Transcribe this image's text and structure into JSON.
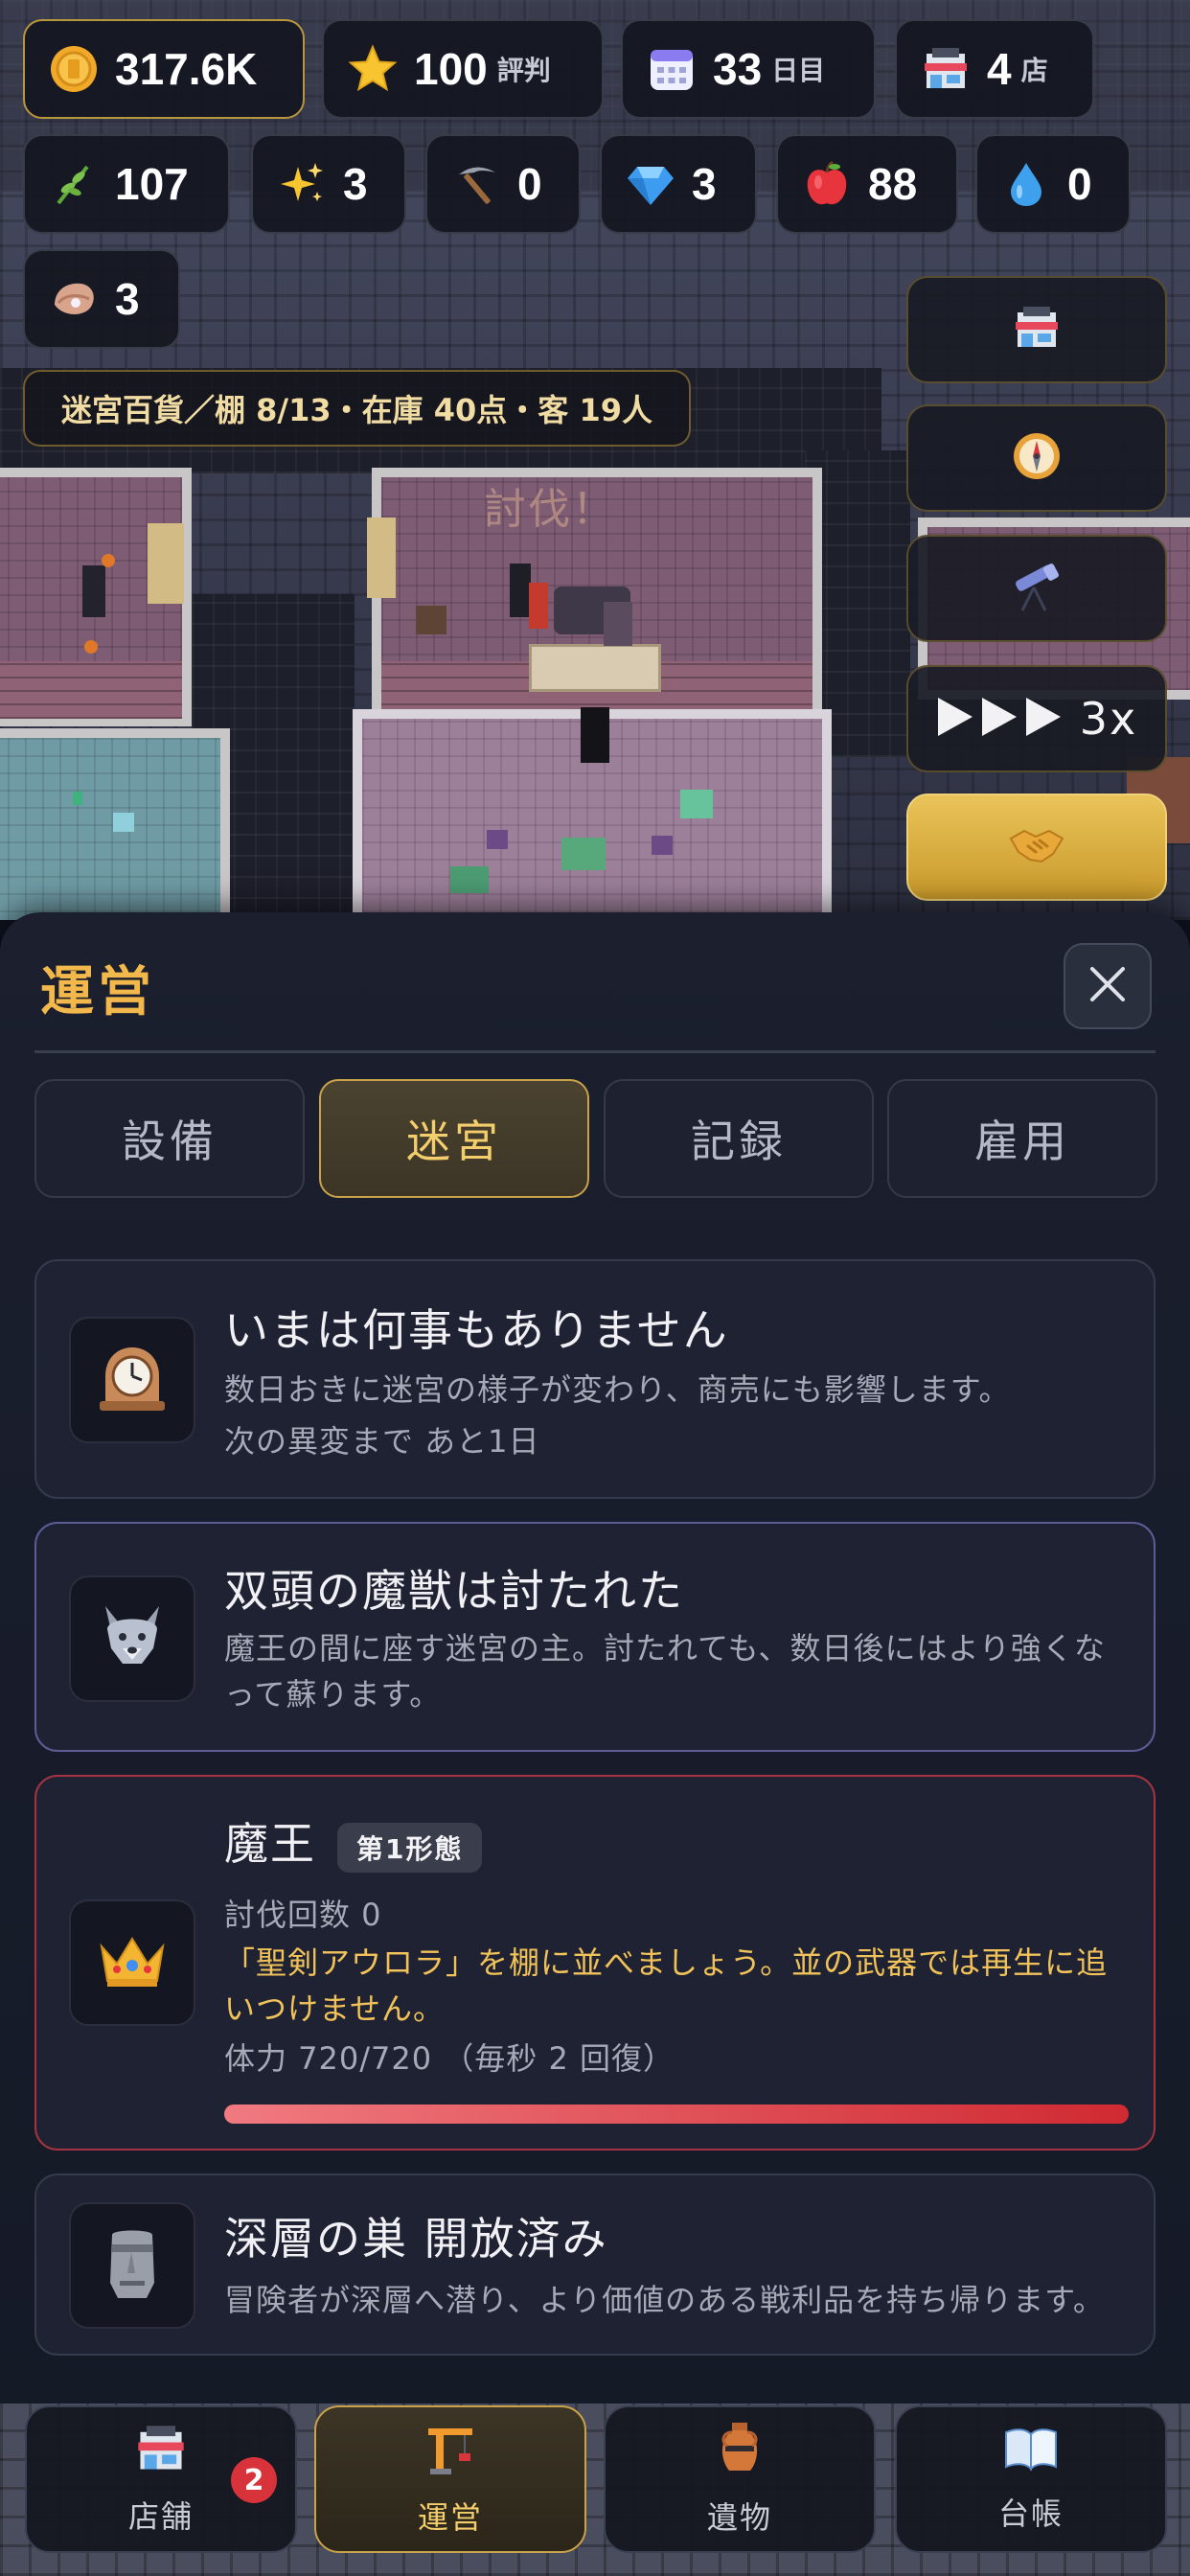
{
  "hud": {
    "row1": [
      {
        "icon": "coin-icon",
        "value": "317.6K",
        "unit": ""
      },
      {
        "icon": "star-icon",
        "value": "100",
        "unit": "評判"
      },
      {
        "icon": "calendar-icon",
        "value": "33",
        "unit": "日目"
      },
      {
        "icon": "store-icon",
        "value": "4",
        "unit": "店"
      }
    ],
    "row2": [
      {
        "icon": "herb-icon",
        "value": "107"
      },
      {
        "icon": "sparkle-icon",
        "value": "3"
      },
      {
        "icon": "pickaxe-icon",
        "value": "0"
      },
      {
        "icon": "gem-icon",
        "value": "3"
      },
      {
        "icon": "apple-icon",
        "value": "88"
      },
      {
        "icon": "water-drop-icon",
        "value": "0"
      }
    ],
    "row3": [
      {
        "icon": "oyster-icon",
        "value": "3"
      }
    ],
    "status": "迷宮百貨／棚 8/13・在庫 40点・客 19人"
  },
  "scene": {
    "room_label": "討伐！"
  },
  "side_buttons": {
    "speed_label": "3x"
  },
  "panel": {
    "title": "運営",
    "tabs": [
      {
        "label": "設備"
      },
      {
        "label": "迷宮"
      },
      {
        "label": "記録"
      },
      {
        "label": "雇用"
      }
    ],
    "cards": {
      "event": {
        "title": "いまは何事もありません",
        "desc": "数日おきに迷宮の様子が変わり、商売にも影響します。",
        "sub": "次の異変まで あと1日"
      },
      "beast": {
        "title": "双頭の魔獣は討たれた",
        "desc_line1": "魔王の間に座す迷宮の主。討たれても、数日後にはより強くな",
        "desc_line2": "って蘇ります。"
      },
      "boss": {
        "title": "魔王",
        "badge": "第1形態",
        "count": "討伐回数 0",
        "hint_line1": "「聖剣アウロラ」を棚に並べましょう。並の武器では再生に追",
        "hint_line2": "いつけません。",
        "hp_text": "体力 720/720 （毎秒 2 回復）",
        "hp_fraction": 1.0
      },
      "nest": {
        "title": "深層の巣 開放済み",
        "desc": "冒険者が深層へ潜り、より価値のある戦利品を持ち帰ります。"
      }
    }
  },
  "nav": {
    "items": [
      {
        "label": "店舗",
        "icon": "store-icon",
        "badge": "2"
      },
      {
        "label": "運営",
        "icon": "crane-icon"
      },
      {
        "label": "遺物",
        "icon": "amphora-icon"
      },
      {
        "label": "台帳",
        "icon": "book-icon"
      }
    ]
  },
  "colors": {
    "accent_gold": "#f2b84b",
    "hp_red": "#d02a32",
    "notification_red": "#d8333b"
  }
}
